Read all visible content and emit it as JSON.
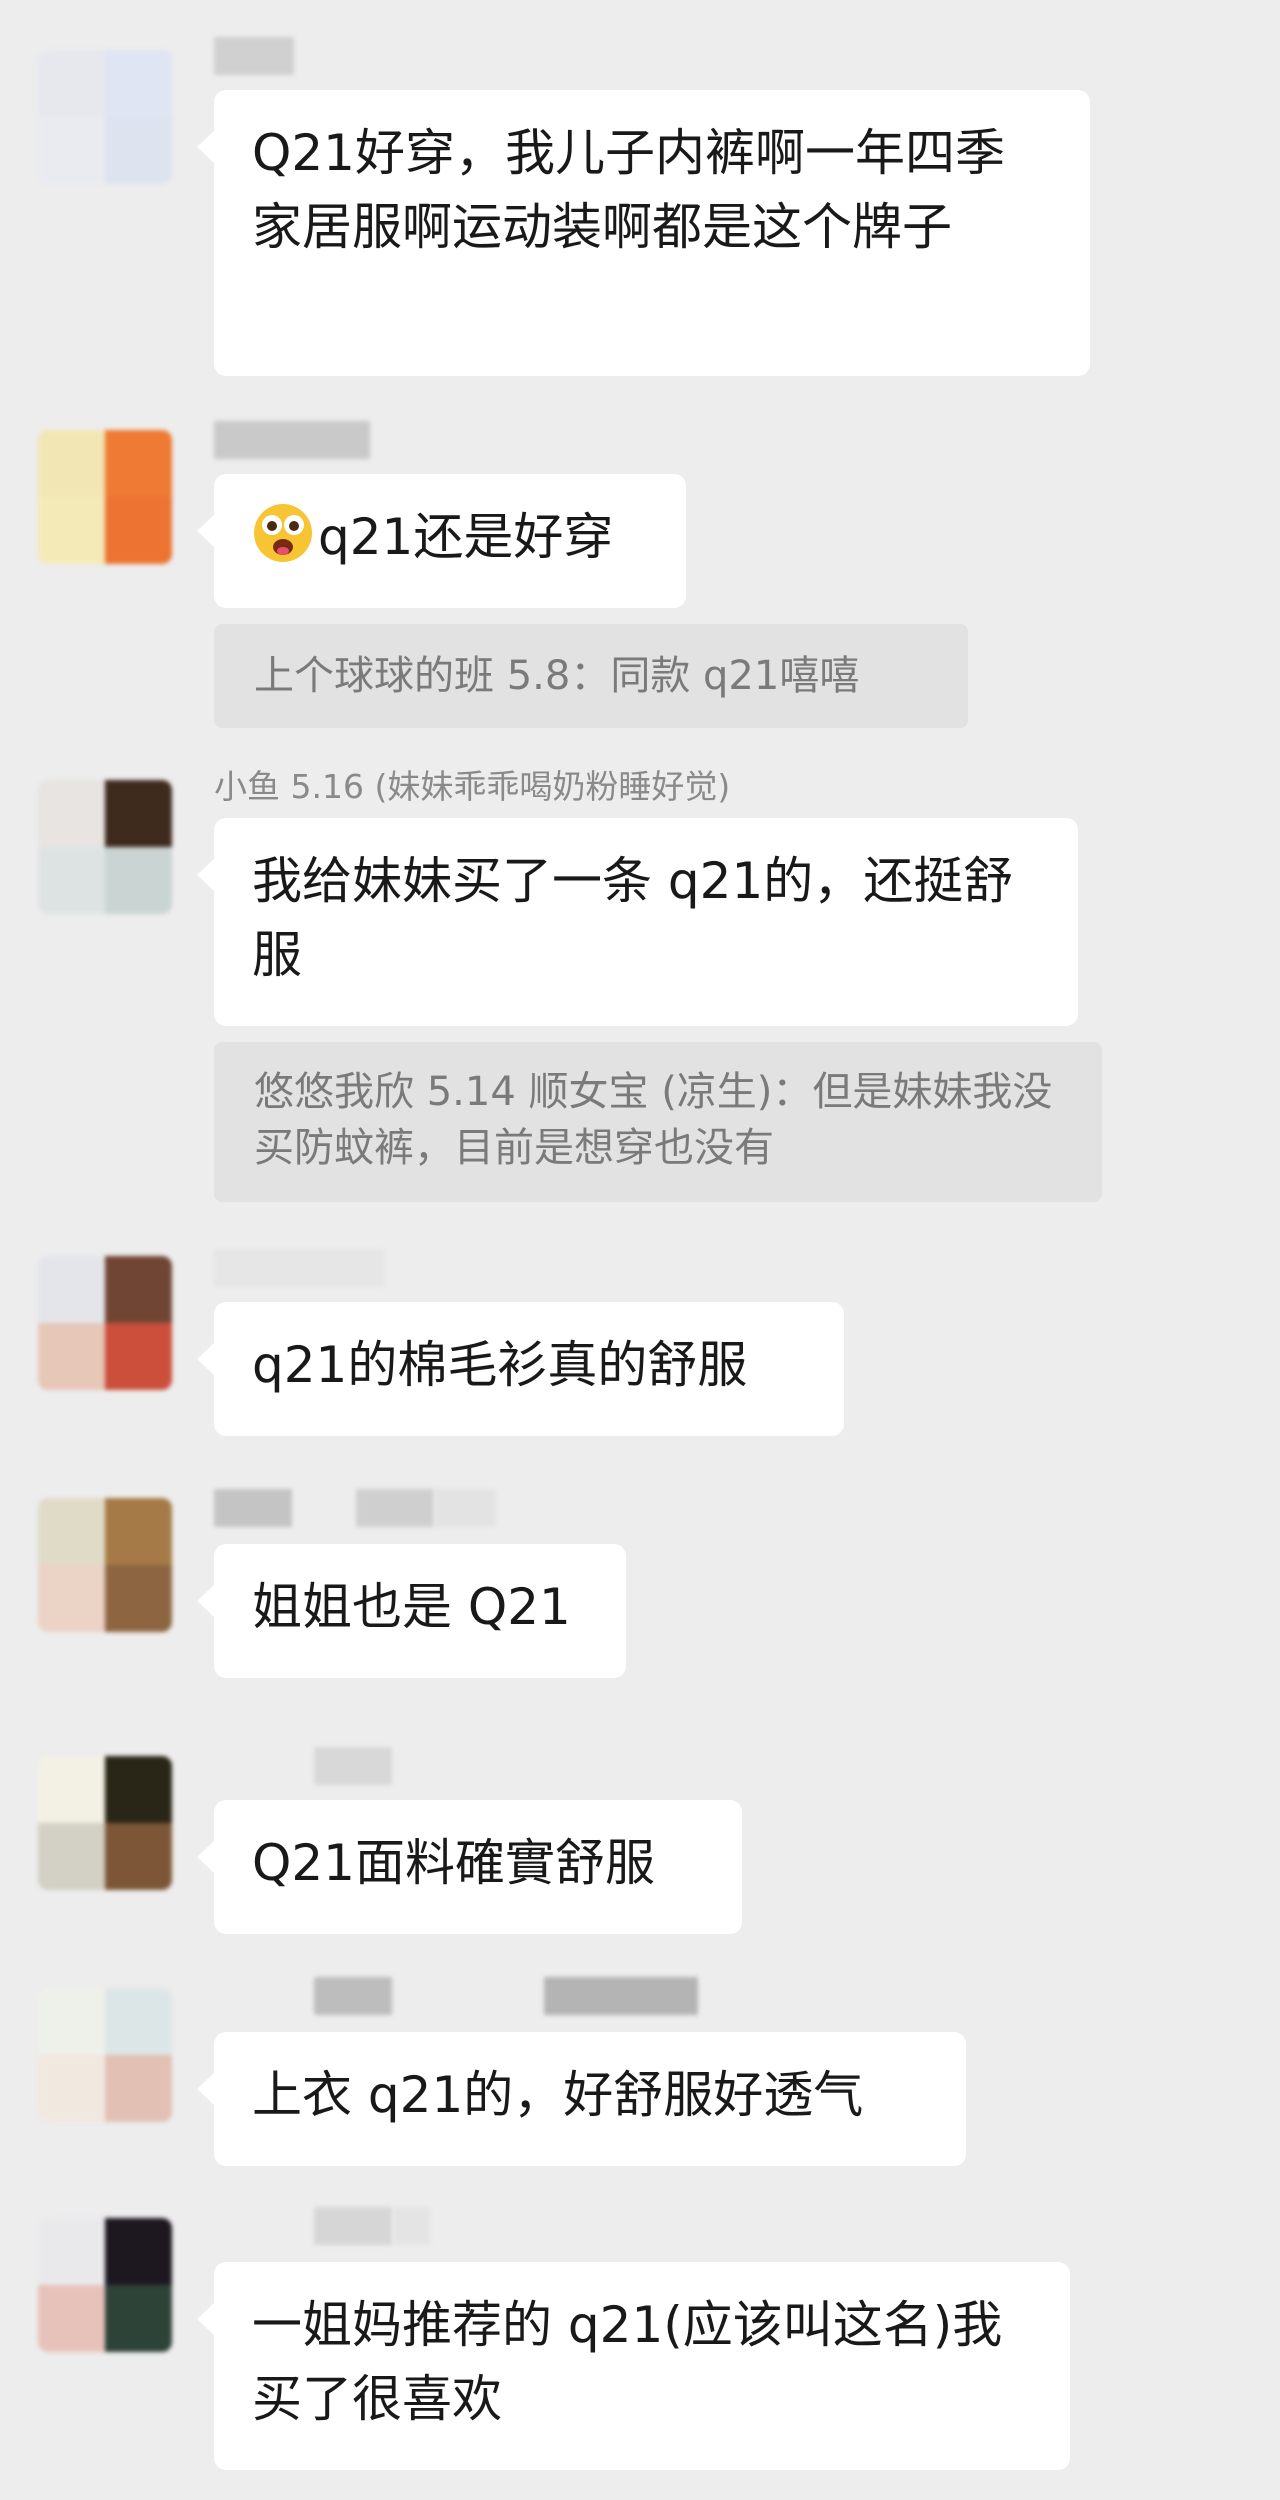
{
  "messages": [
    {
      "nickname": "",
      "text": "Q21好穿，我儿子内裤啊一年四季家居服啊运动装啊都是这个牌子",
      "avatar_colors": [
        "#e6e8ee",
        "#dfe5f2",
        "#e9ebf0",
        "#dde3ef"
      ]
    },
    {
      "nickname": "",
      "emoji_icon": "drooling-face-icon",
      "text": "q21还是好穿",
      "quote": "上个球球的班 5.8：同款 q21嘻嘻",
      "avatar_colors": [
        "#f2e6b4",
        "#ee7a33",
        "#f4eab8",
        "#ec7331"
      ]
    },
    {
      "nickname": "小鱼 5.16 (妹妹乖乖喝奶粉睡好觉)",
      "text": "我给妹妹买了一条 q21的，还挺舒服",
      "quote": "悠悠我欣 5.14 顺女宝 (凉生)：但是妹妹我没买防蚊裤，目前是想穿也没有",
      "avatar_colors": [
        "#e7e4e2",
        "#3f2b1e",
        "#dde3e3",
        "#cad4d2"
      ]
    },
    {
      "nickname": "",
      "text": "q21的棉毛衫真的舒服",
      "avatar_colors": [
        "#e4e5ea",
        "#714534",
        "#e6c7b8",
        "#cc4f3c"
      ]
    },
    {
      "nickname": "",
      "text": "姐姐也是 Q21",
      "avatar_colors": [
        "#e0dbc7",
        "#a57a46",
        "#ebd3c6",
        "#8d6641"
      ]
    },
    {
      "nickname": "",
      "text": "Q21面料確實舒服",
      "avatar_colors": [
        "#f3f0e4",
        "#2a2617",
        "#d3d0c5",
        "#7c5637"
      ]
    },
    {
      "nickname": "",
      "text": "上衣 q21的，好舒服好透气",
      "avatar_colors": [
        "#eef0ea",
        "#dde6e6",
        "#f1e8e0",
        "#e3c0b4"
      ]
    },
    {
      "nickname": "",
      "text": "一姐妈推荐的 q21(应该叫这名)我买了很喜欢",
      "avatar_colors": [
        "#e9e9ec",
        "#1d1720",
        "#e7c2ba",
        "#2e4338"
      ]
    }
  ]
}
